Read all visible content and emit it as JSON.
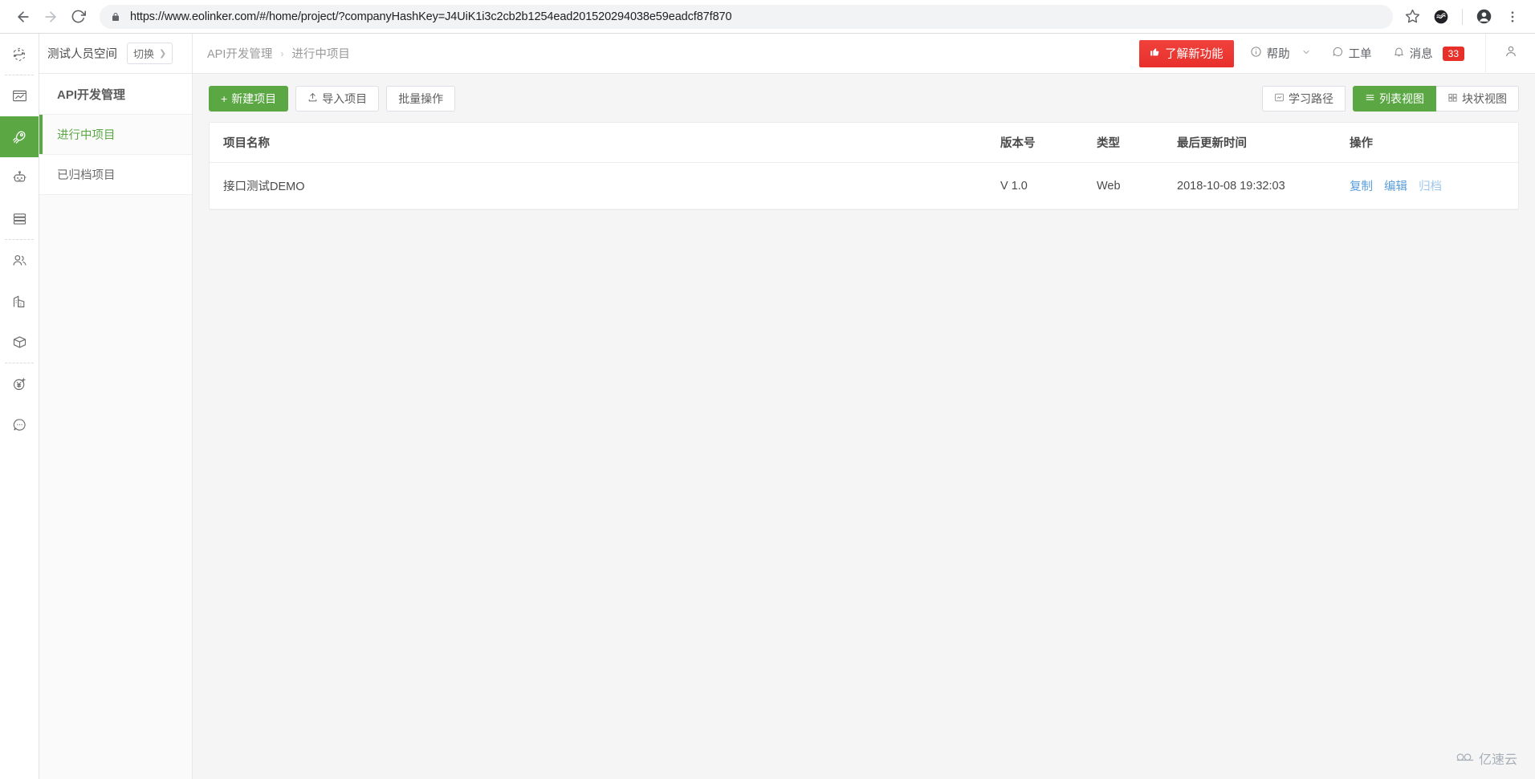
{
  "browser": {
    "url": "https://www.eolinker.com/#/home/project/?companyHashKey=J4UiK1i3c2cb2b1254ead201520294038e59eadcf87f870",
    "back_label": "back-arrow",
    "forward_label": "forward-arrow",
    "reload_label": "reload",
    "lock_label": "secure-lock",
    "bookmark_label": "star",
    "extension_label": "extension",
    "profile_label": "profile",
    "menu_label": "menu"
  },
  "rail": {
    "items": [
      {
        "icon": "logo-icon",
        "label": "eolinker-logo",
        "active": false
      },
      {
        "icon": "monitor-icon",
        "label": "api-monitor",
        "active": false
      },
      {
        "icon": "rocket-icon",
        "label": "api-development",
        "active": true
      },
      {
        "icon": "robot-icon",
        "label": "automated-test",
        "active": false
      },
      {
        "icon": "database-icon",
        "label": "data-management",
        "active": false
      },
      {
        "icon": "users-icon",
        "label": "team-members",
        "active": false
      },
      {
        "icon": "building-icon",
        "label": "company",
        "active": false
      },
      {
        "icon": "box-icon",
        "label": "resources",
        "active": false
      },
      {
        "icon": "yen-icon",
        "label": "billing",
        "active": false
      },
      {
        "icon": "chat-icon",
        "label": "feedback",
        "active": false
      }
    ]
  },
  "workspace": {
    "name": "测试人员空间",
    "switch_label": "切换"
  },
  "sidebar": {
    "section_title": "API开发管理",
    "items": [
      {
        "label": "进行中项目",
        "active": true
      },
      {
        "label": "已归档项目",
        "active": false
      }
    ]
  },
  "breadcrumb": {
    "root": "API开发管理",
    "separator": "›",
    "current": "进行中项目"
  },
  "header_actions": {
    "new_feature": "了解新功能",
    "help": "帮助",
    "ticket": "工单",
    "message": "消息",
    "message_count": "33"
  },
  "toolbar": {
    "new_project": "新建项目",
    "import_project": "导入项目",
    "batch_operation": "批量操作",
    "learning_path": "学习路径",
    "list_view": "列表视图",
    "block_view": "块状视图"
  },
  "table": {
    "columns": {
      "name": "项目名称",
      "version": "版本号",
      "type": "类型",
      "updated": "最后更新时间",
      "actions": "操作"
    },
    "rows": [
      {
        "name": "接口测试DEMO",
        "version": "V 1.0",
        "type": "Web",
        "updated": "2018-10-08 19:32:03",
        "actions": [
          "复制",
          "编辑",
          "归档"
        ]
      }
    ]
  },
  "watermark": {
    "text": "亿速云"
  },
  "colors": {
    "brand_green": "#5aa743",
    "alert_red": "#e8302b",
    "link_blue": "#5a9ddb"
  }
}
